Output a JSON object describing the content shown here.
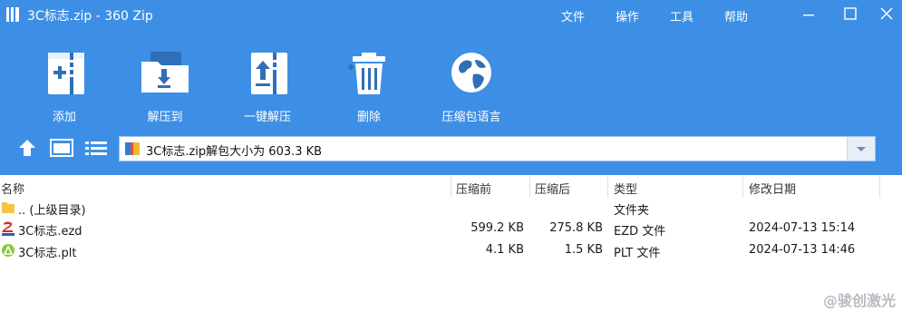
{
  "window": {
    "title": "3C标志.zip - 360 Zip",
    "menu": [
      "文件",
      "操作",
      "工具",
      "帮助"
    ]
  },
  "toolbar": {
    "add": "添加",
    "extract_to": "解压到",
    "one_click_extract": "一键解压",
    "delete": "删除",
    "language_pack": "压缩包语言"
  },
  "address": {
    "text": "3C标志.zip解包大小为 603.3 KB"
  },
  "columns": {
    "name": "名称",
    "compressed_before": "压缩前",
    "compressed_after": "压缩后",
    "type": "类型",
    "modified": "修改日期"
  },
  "rows": [
    {
      "name": ".. (上级目录)",
      "before": "",
      "after": "",
      "type": "文件夹",
      "modified": "",
      "icon": "folder-icon"
    },
    {
      "name": "3C标志.ezd",
      "before": "599.2 KB",
      "after": "275.8 KB",
      "type": "EZD 文件",
      "modified": "2024-07-13 15:14",
      "icon": "ezcad-file-icon"
    },
    {
      "name": "3C标志.plt",
      "before": "4.1 KB",
      "after": "1.5 KB",
      "type": "PLT 文件",
      "modified": "2024-07-13 14:46",
      "icon": "plt-file-icon"
    }
  ],
  "watermark": "@骏创激光",
  "colors": {
    "accent": "#3d8fe6",
    "selected": "#cfe3fa"
  }
}
